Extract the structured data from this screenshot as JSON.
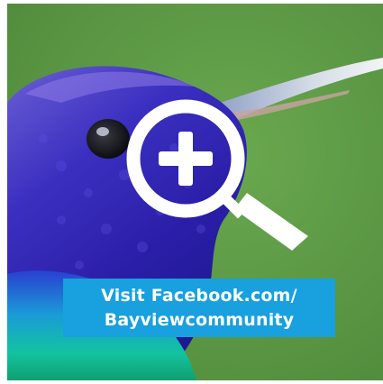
{
  "image": {
    "subject": "hummingbird-close-up",
    "background_color": "#5d9a46",
    "accent_color": "#18a0df"
  },
  "overlay": {
    "icon": "zoom-in-icon"
  },
  "caption": {
    "line1": "Visit Facebook.com/",
    "line2": "Bayviewcommunity"
  }
}
